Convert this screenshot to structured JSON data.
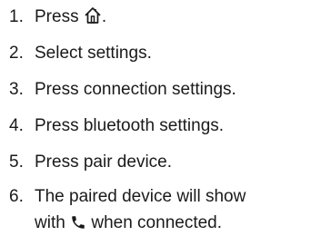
{
  "steps": [
    {
      "number": "1.",
      "before_icon": "Press ",
      "icon": "home-icon",
      "after_icon": "."
    },
    {
      "number": "2.",
      "text": "Select settings."
    },
    {
      "number": "3.",
      "text": "Press connection settings."
    },
    {
      "number": "4.",
      "text": "Press bluetooth settings."
    },
    {
      "number": "5.",
      "text": "Press pair device."
    },
    {
      "number": "6.",
      "line1": "The paired device will show",
      "before_icon": "with ",
      "icon": "phone-icon",
      "after_icon": " when connected."
    }
  ]
}
